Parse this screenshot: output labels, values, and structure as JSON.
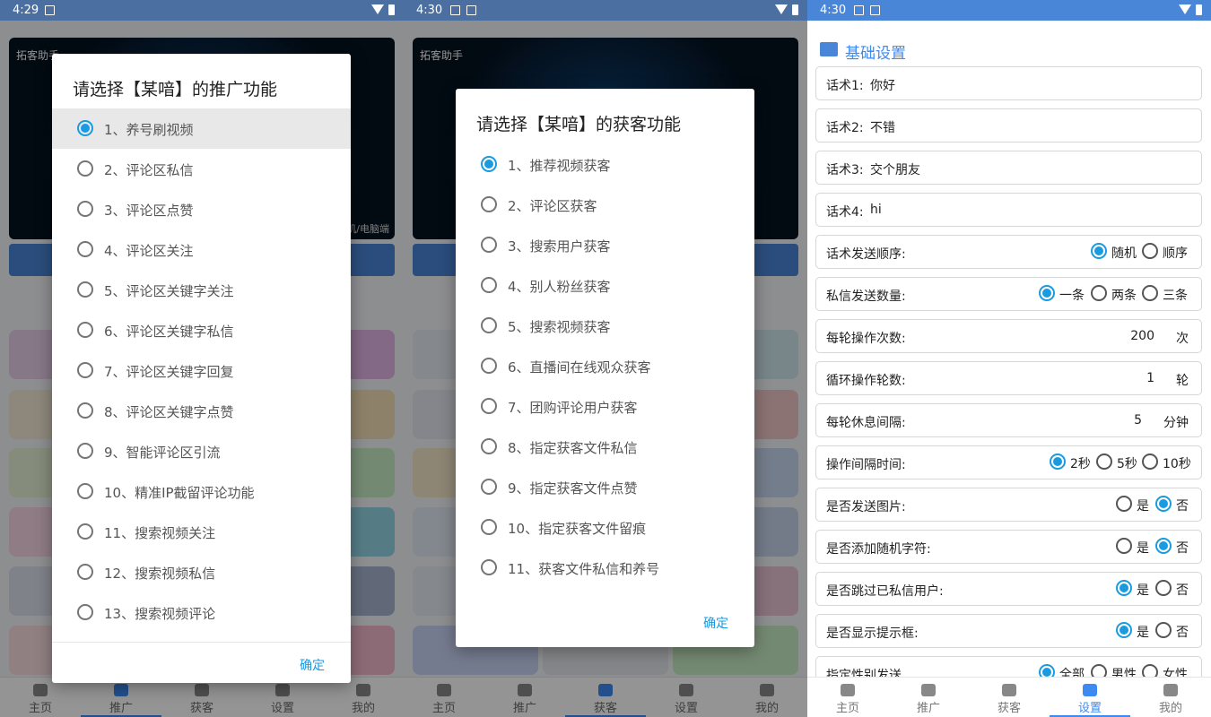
{
  "status": {
    "time1": "4:29",
    "time2": "4:30",
    "time3": "4:30"
  },
  "banner_label": "拓客助手",
  "banner_sub": "手机/电脑端",
  "nav": [
    "主页",
    "推广",
    "获客",
    "设置",
    "我的"
  ],
  "dialog1": {
    "title": "请选择【某喑】的推广功能",
    "options": [
      "1、养号刷视频",
      "2、评论区私信",
      "3、评论区点赞",
      "4、评论区关注",
      "5、评论区关键字关注",
      "6、评论区关键字私信",
      "7、评论区关键字回复",
      "8、评论区关键字点赞",
      "9、智能评论区引流",
      "10、精准IP截留评论功能",
      "11、搜索视频关注",
      "12、搜索视频私信",
      "13、搜索视频评论"
    ],
    "ok": "确定"
  },
  "dialog2": {
    "title": "请选择【某喑】的获客功能",
    "options": [
      "1、推荐视频获客",
      "2、评论区获客",
      "3、搜索用户获客",
      "4、别人粉丝获客",
      "5、搜索视频获客",
      "6、直播间在线观众获客",
      "7、团购评论用户获客",
      "8、指定获客文件私信",
      "9、指定获客文件点赞",
      "10、指定获客文件留痕",
      "11、获客文件私信和养号"
    ],
    "ok": "确定"
  },
  "settings": {
    "header": "基础设置",
    "script1_label": "话术1:",
    "script1": "你好",
    "script2_label": "话术2:",
    "script2": "不错",
    "script3_label": "话术3:",
    "script3": "交个朋友",
    "script4_label": "话术4:",
    "script4": "hi",
    "order_label": "话术发送顺序:",
    "order_opts": [
      "随机",
      "顺序"
    ],
    "count_label": "私信发送数量:",
    "count_opts": [
      "一条",
      "两条",
      "三条"
    ],
    "ops_label": "每轮操作次数:",
    "ops_value": "200",
    "ops_unit": "次",
    "rounds_label": "循环操作轮数:",
    "rounds_value": "1",
    "rounds_unit": "轮",
    "rest_label": "每轮休息间隔:",
    "rest_value": "5",
    "rest_unit": "分钟",
    "interval_label": "操作间隔时间:",
    "interval_opts": [
      "2秒",
      "5秒",
      "10秒"
    ],
    "img_label": "是否发送图片:",
    "randchar_label": "是否添加随机字符:",
    "skip_label": "是否跳过已私信用户:",
    "tip_label": "是否显示提示框:",
    "yes": "是",
    "no": "否",
    "gender_label": "指定性别发送",
    "gender_opts": [
      "全部",
      "男性",
      "女性"
    ]
  }
}
